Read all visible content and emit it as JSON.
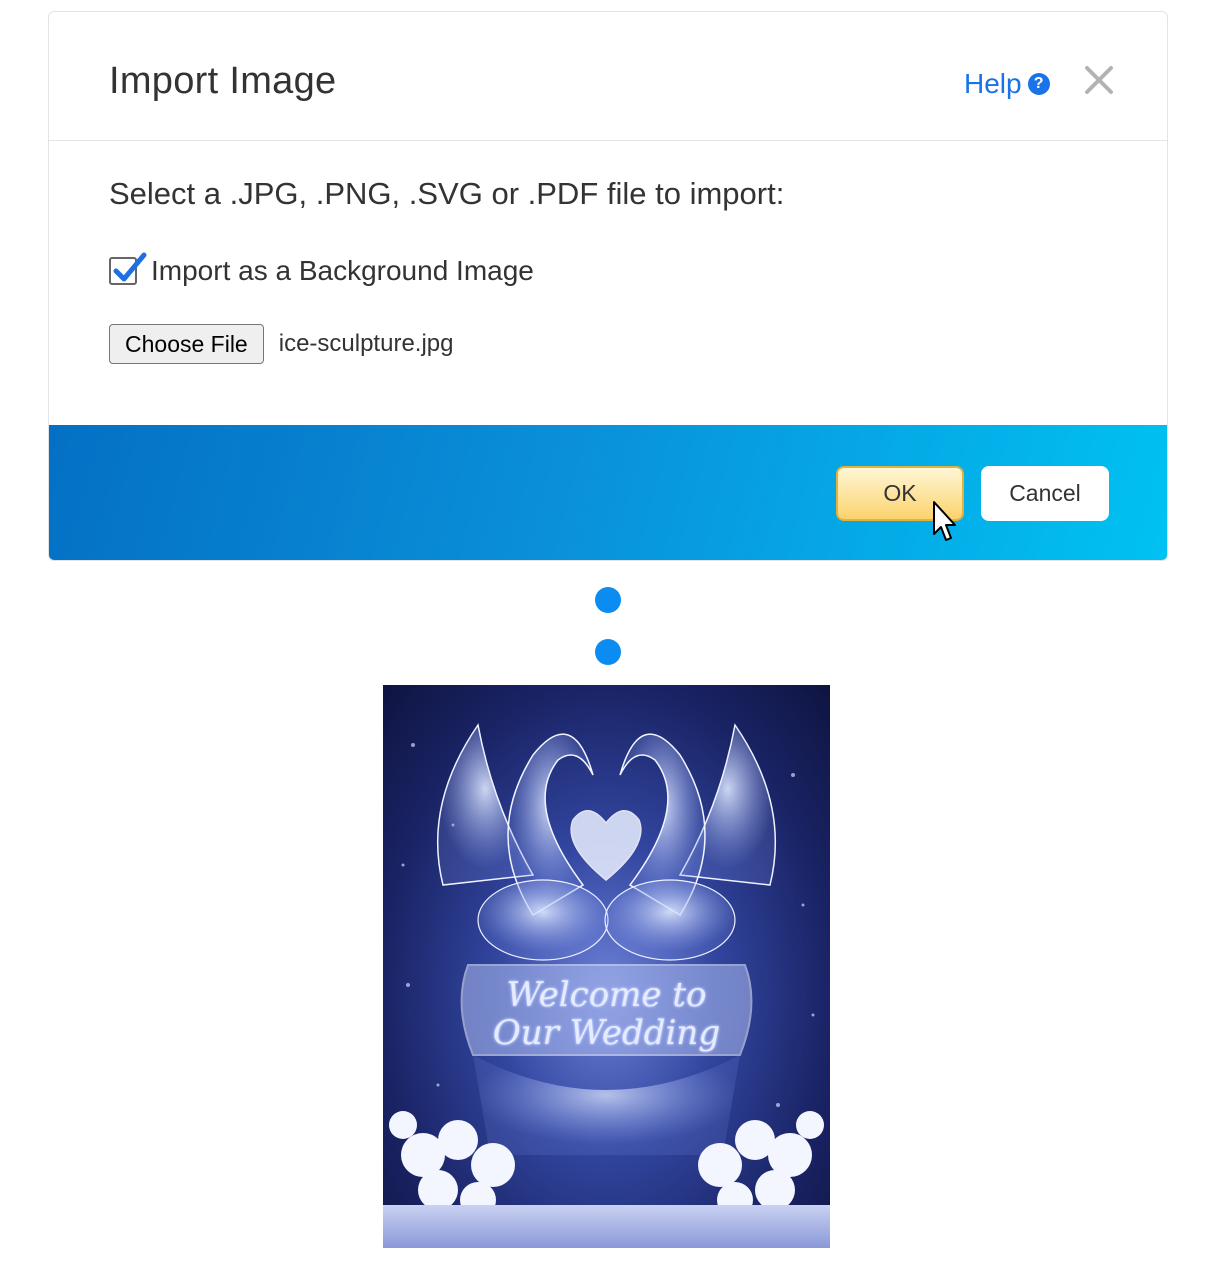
{
  "dialog": {
    "title": "Import Image",
    "help_label": "Help",
    "help_icon": "question-circle-icon",
    "close_icon": "close-icon",
    "instruction": "Select a .JPG, .PNG, .SVG or .PDF file to import:",
    "background_checkbox": {
      "label": "Import as a Background Image",
      "checked": true
    },
    "file_input": {
      "button_label": "Choose File",
      "file_name": "ice-sculpture.jpg"
    },
    "ok_label": "OK",
    "cancel_label": "Cancel"
  },
  "preview": {
    "caption_line1": "Welcome to",
    "caption_line2": "Our Wedding"
  },
  "colors": {
    "accent_link": "#1a73e8",
    "footer_gradient_start": "#0470c4",
    "footer_gradient_end": "#00c2f2",
    "ok_button": "#fbd36d",
    "handle": "#0a8cf0"
  }
}
